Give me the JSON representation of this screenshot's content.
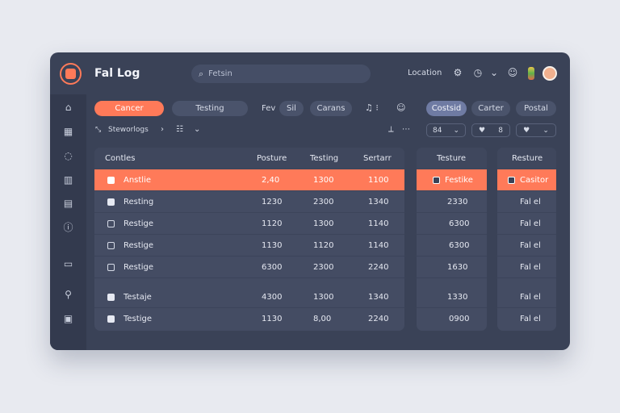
{
  "header": {
    "title": "Fal Log",
    "search_placeholder": "Fetsin",
    "location": "Location"
  },
  "icons": {
    "logo": "logo-icon",
    "settings": "gear-icon",
    "clock": "clock-icon",
    "chevron": "chevron-down-icon",
    "smile": "smile-icon"
  },
  "colors": {
    "accent": "#ff7a59",
    "window": "#3a4257",
    "panel": "#444c63",
    "chip_blue": "#6f7ba3"
  },
  "toolbar": {
    "chips": [
      "Cancer",
      "Testing"
    ],
    "fev": "Fev",
    "sil": "Sil",
    "carans": "Carans",
    "right_chips": [
      "Costsid",
      "Carter",
      "Postal"
    ]
  },
  "subbar": {
    "breadcrumb": "Steworlogs",
    "chev": "›"
  },
  "mini_controls": [
    {
      "a": "84",
      "b": "⌄"
    },
    {
      "a": "♥",
      "b": "8"
    },
    {
      "a": "♥",
      "b": "⌄"
    }
  ],
  "table_main": {
    "headers": [
      "Contles",
      "Posture",
      "Testing",
      "Sertarr"
    ],
    "rows": [
      {
        "name": "Anstlie",
        "v1": "2,40",
        "v2": "1300",
        "v3": "1100"
      },
      {
        "name": "Resting",
        "v1": "1230",
        "v2": "2300",
        "v3": "1340"
      },
      {
        "name": "Restige",
        "v1": "1120",
        "v2": "1300",
        "v3": "1140"
      },
      {
        "name": "Restige",
        "v1": "1130",
        "v2": "1120",
        "v3": "1140"
      },
      {
        "name": "Restige",
        "v1": "6300",
        "v2": "2300",
        "v3": "2240"
      },
      {
        "name": "Testaje",
        "v1": "4300",
        "v2": "1300",
        "v3": "1340"
      },
      {
        "name": "Testige",
        "v1": "1130",
        "v2": "8,00",
        "v3": "2240"
      }
    ]
  },
  "table_mid": {
    "header": "Testure",
    "rows": [
      {
        "name": "Festike"
      },
      {
        "v": "2330"
      },
      {
        "v": "6300"
      },
      {
        "v": "6300"
      },
      {
        "v": "1630"
      },
      {
        "v": "1330"
      },
      {
        "v": "0900"
      }
    ]
  },
  "table_right": {
    "header": "Resture",
    "rows": [
      {
        "name": "Casitor"
      },
      {
        "v": "Fal el"
      },
      {
        "v": "Fal el"
      },
      {
        "v": "Fal el"
      },
      {
        "v": "Fal el"
      },
      {
        "v": "Fal el"
      },
      {
        "v": "Fal el"
      }
    ]
  }
}
